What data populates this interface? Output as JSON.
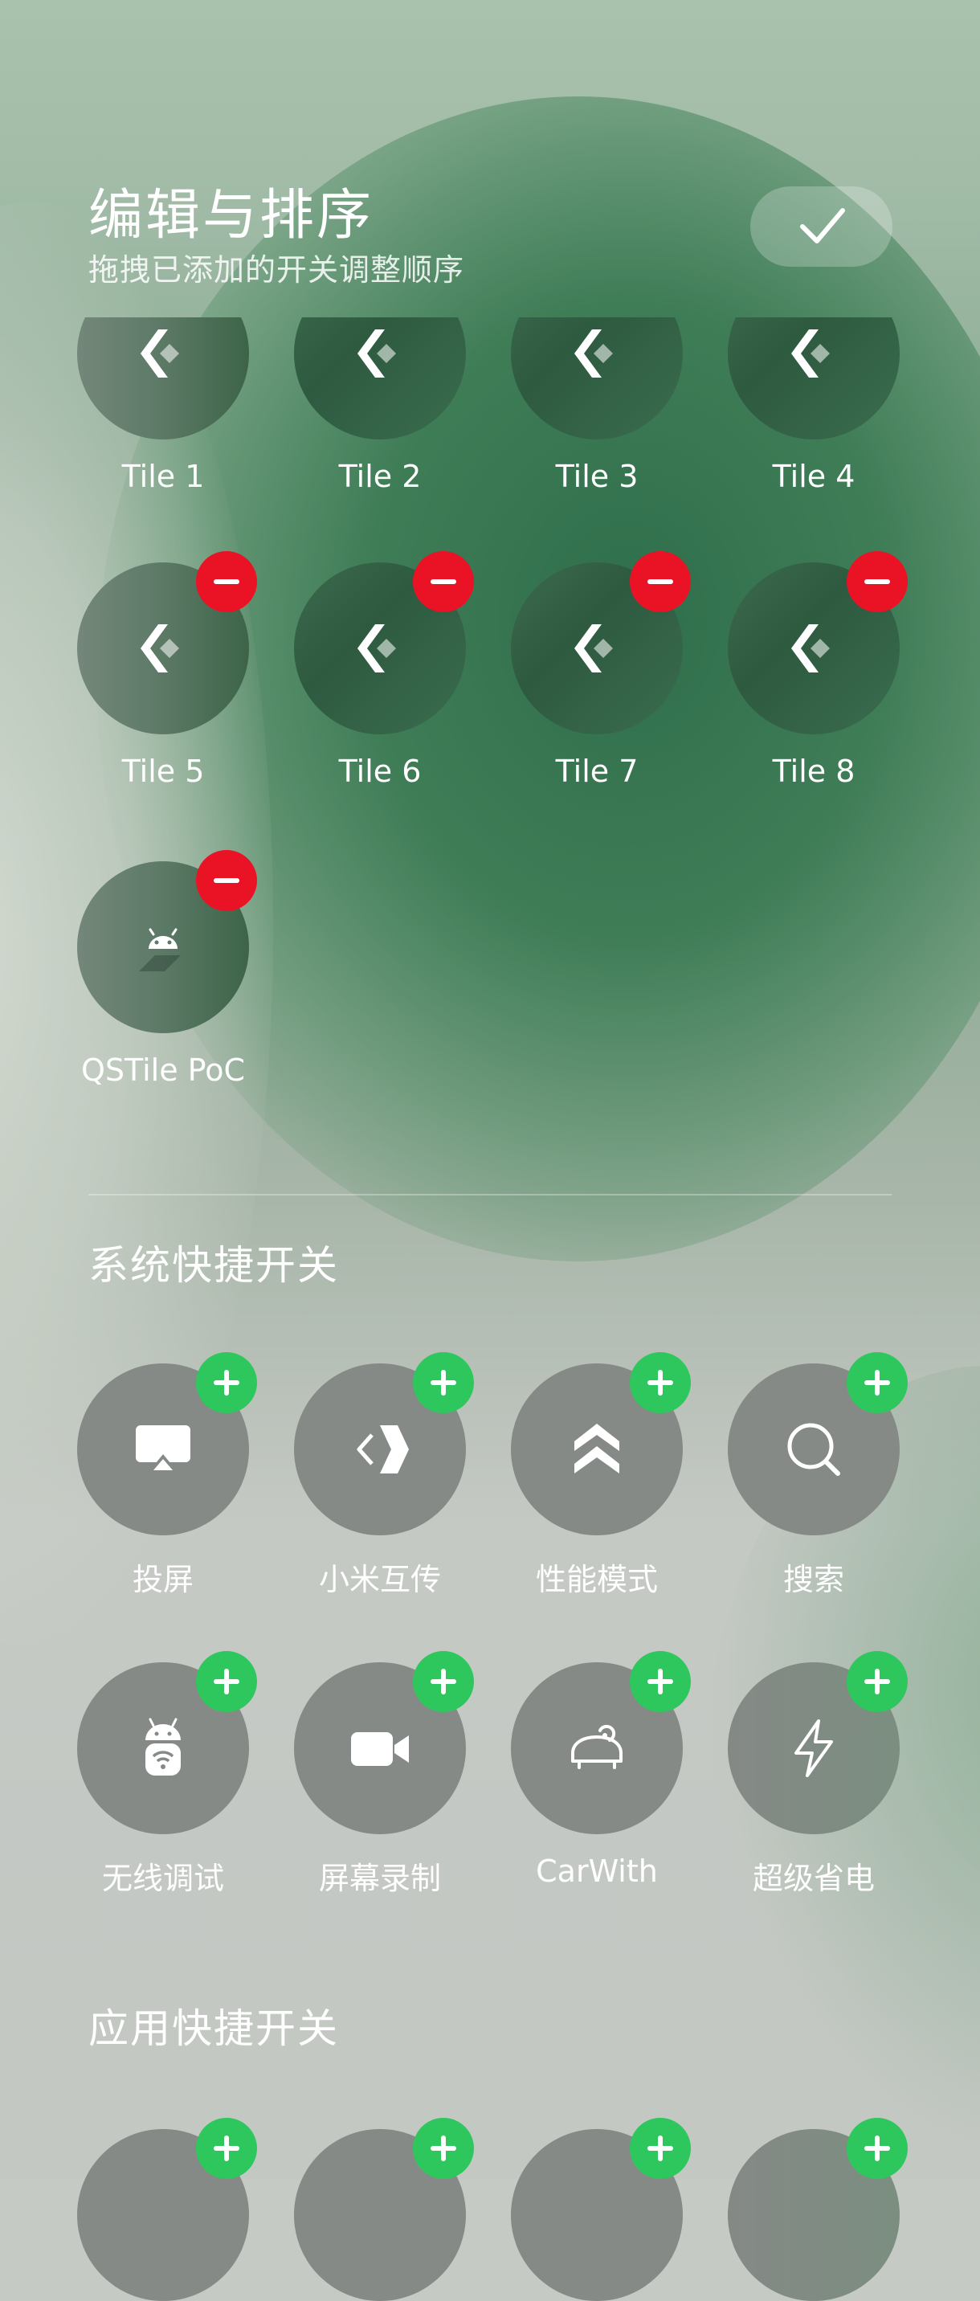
{
  "header": {
    "title": "编辑与排序",
    "subtitle": "拖拽已添加的开关调整顺序"
  },
  "added_tiles": [
    {
      "label": "Tile 1",
      "icon": "kde-connect-icon"
    },
    {
      "label": "Tile 2",
      "icon": "kde-connect-icon"
    },
    {
      "label": "Tile 3",
      "icon": "kde-connect-icon"
    },
    {
      "label": "Tile 4",
      "icon": "kde-connect-icon"
    },
    {
      "label": "Tile 5",
      "icon": "kde-connect-icon"
    },
    {
      "label": "Tile 6",
      "icon": "kde-connect-icon"
    },
    {
      "label": "Tile 7",
      "icon": "kde-connect-icon"
    },
    {
      "label": "Tile 8",
      "icon": "kde-connect-icon"
    },
    {
      "label": "QSTile PoC",
      "icon": "android-icon"
    }
  ],
  "system_section": {
    "title": "系统快捷开关",
    "tiles": [
      {
        "label": "投屏",
        "icon": "cast-screen-icon"
      },
      {
        "label": "小米互传",
        "icon": "mi-share-icon"
      },
      {
        "label": "性能模式",
        "icon": "performance-mode-icon"
      },
      {
        "label": "搜索",
        "icon": "search-icon"
      },
      {
        "label": "无线调试",
        "icon": "wireless-debug-icon"
      },
      {
        "label": "屏幕录制",
        "icon": "screen-record-icon"
      },
      {
        "label": "CarWith",
        "icon": "carwith-icon"
      },
      {
        "label": "超级省电",
        "icon": "power-save-icon"
      }
    ]
  },
  "app_section": {
    "title": "应用快捷开关"
  },
  "colors": {
    "remove_badge": "#ea1326",
    "add_badge": "#2ec75d",
    "tile_dark": "#2e5a40",
    "tile_gray": "#868a86"
  }
}
